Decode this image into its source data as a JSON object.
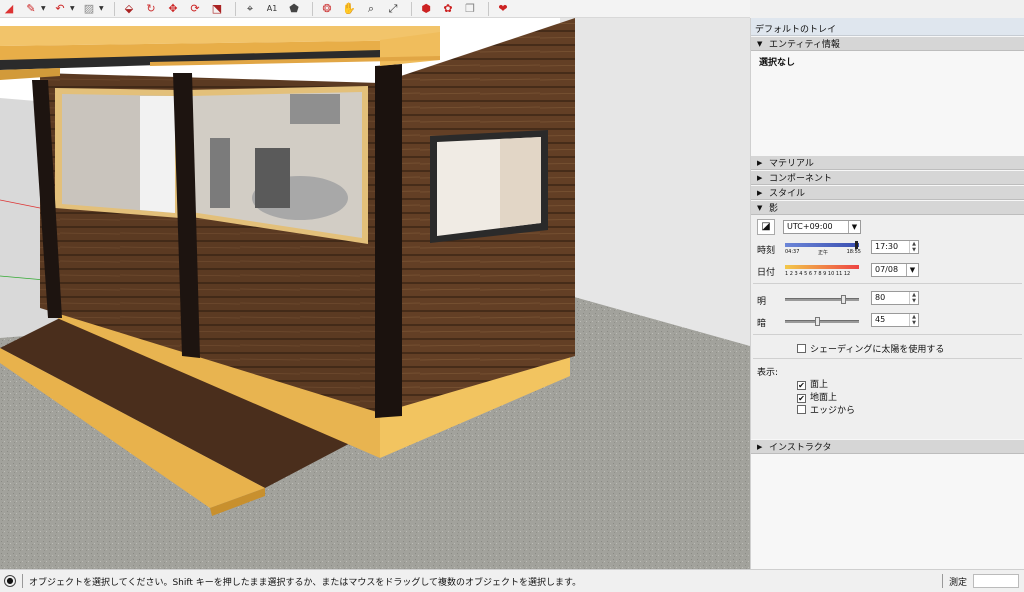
{
  "toolbar": {
    "icons": [
      "eraser-icon",
      "pencil-icon",
      "arc-icon",
      "shape-icon",
      "push-pull-icon",
      "follow-me-icon",
      "move-icon",
      "rotate-icon",
      "scale-icon",
      "paint-bucket-icon",
      "dimension-icon",
      "text-icon",
      "paint-icon",
      "section-icon",
      "walk-icon",
      "zoom-icon",
      "zoom-extents-icon",
      "warehouse-icon",
      "extension-icon",
      "model-info-icon",
      "ruby-icon"
    ]
  },
  "tray": {
    "title": "デフォルトのトレイ",
    "entity_info": {
      "header": "エンティティ情報",
      "value": "選択なし"
    },
    "sections": {
      "materials": "マテリアル",
      "components": "コンポーネント",
      "styles": "スタイル",
      "shadows": "影",
      "instructor": "インストラクタ"
    },
    "shadows": {
      "timezone": "UTC+09:00",
      "time_label": "時刻",
      "time_start": "04:37",
      "time_noon": "正午",
      "time_end": "18:55",
      "time_value": "17:30",
      "date_label": "日付",
      "months": "1 2 3 4 5 6 7 8 9 10 11 12",
      "date_value": "07/08",
      "light_label": "明",
      "light_value": "80",
      "light_level": 0.8,
      "dark_label": "暗",
      "dark_value": "45",
      "dark_level": 0.45,
      "use_sun_label": "シェーディングに太陽を使用する",
      "use_sun_checked": false,
      "display_label": "表示:",
      "on_faces_label": "面上",
      "on_faces_checked": true,
      "on_ground_label": "地面上",
      "on_ground_checked": true,
      "from_edges_label": "エッジから",
      "from_edges_checked": false
    }
  },
  "status": {
    "message": "オブジェクトを選択してください。Shift キーを押したまま選択するか、またはマウスをドラッグして複数のオブジェクトを選択します。",
    "measure_label": "測定"
  },
  "colors": {
    "wood_dark": "#5a3a22",
    "wood_light": "#e8b04e",
    "ground": "#9e9e98",
    "window_frame": "#1a1a1a"
  }
}
